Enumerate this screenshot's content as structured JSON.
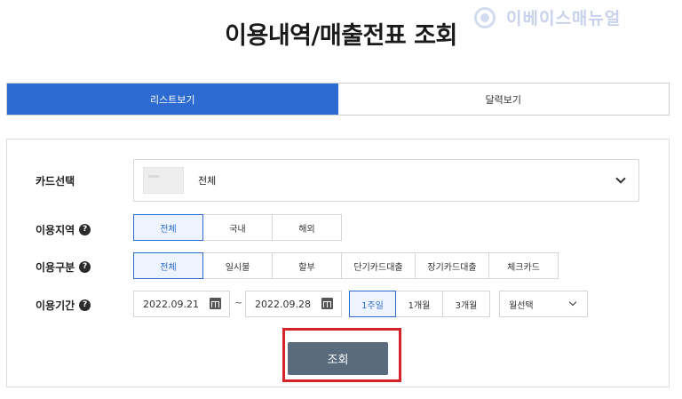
{
  "header": {
    "title": "이용내역/매출전표 조회",
    "watermark": "이베이스매뉴얼"
  },
  "view_tabs": [
    {
      "label": "리스트보기",
      "active": true
    },
    {
      "label": "달력보기",
      "active": false
    }
  ],
  "filters": {
    "card": {
      "label": "카드선택",
      "value": "전체",
      "icon": "chevron-down-icon"
    },
    "region": {
      "label": "이용지역",
      "help_icon": "?",
      "options": [
        "전체",
        "국내",
        "해외"
      ],
      "selected": "전체"
    },
    "type": {
      "label": "이용구분",
      "help_icon": "?",
      "options": [
        "전체",
        "일시불",
        "할부",
        "단기카드대출",
        "장기카드대출",
        "체크카드"
      ],
      "selected": "전체"
    },
    "period": {
      "label": "이용기간",
      "help_icon": "?",
      "start_date": "2022.09.21",
      "separator": "~",
      "end_date": "2022.09.28",
      "quick_options": [
        "1주일",
        "1개월",
        "3개월"
      ],
      "selected": "1주일",
      "month_select": "월선택"
    }
  },
  "actions": {
    "search_label": "조회"
  },
  "colors": {
    "accent": "#2d6bd2",
    "search_button": "#5a6b7e",
    "highlight": "#d6232a"
  }
}
